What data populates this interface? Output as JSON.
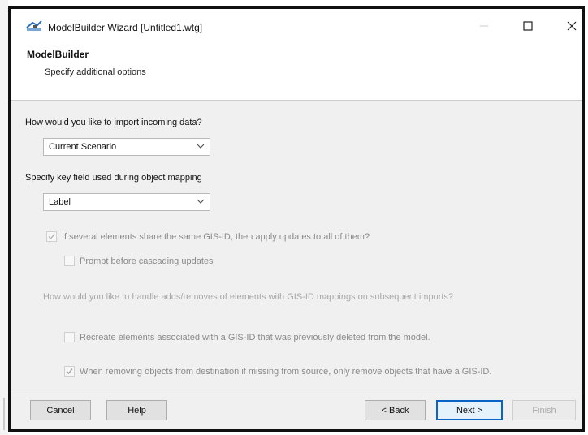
{
  "window": {
    "title": "ModelBuilder Wizard [Untitled1.wtg]",
    "controls": {
      "minimize": "minimize-icon",
      "maximize": "maximize-icon",
      "close": "close-icon"
    }
  },
  "header": {
    "title": "ModelBuilder",
    "subtitle": "Specify additional options"
  },
  "main": {
    "import_question": "How would you like to import incoming data?",
    "import_selected": "Current Scenario",
    "keyfield_question": "Specify key field used during object mapping",
    "keyfield_selected": "Label",
    "apply_all_label": "If several elements share the same GIS-ID, then apply updates to all of them?",
    "prompt_label": "Prompt before cascading updates",
    "adds_question": "How would you like to handle adds/removes of elements with GIS-ID mappings on subsequent imports?",
    "recreate_label": "Recreate elements associated with a GIS-ID that was previously deleted from the model.",
    "remove_label": "When removing objects from destination if missing from source, only remove objects that have a GIS-ID."
  },
  "state": {
    "apply_all_checked": true,
    "prompt_checked": false,
    "recreate_checked": false,
    "remove_checked": true,
    "apply_all_enabled": false,
    "prompt_enabled": false,
    "recreate_enabled": true,
    "remove_enabled": true
  },
  "footer": {
    "cancel": "Cancel",
    "help": "Help",
    "back": "< Back",
    "next": "Next >",
    "finish": "Finish"
  },
  "colors": {
    "accent": "#0a64c8",
    "panel": "#f0f0f0",
    "disabled_text": "#a8a8a8"
  }
}
